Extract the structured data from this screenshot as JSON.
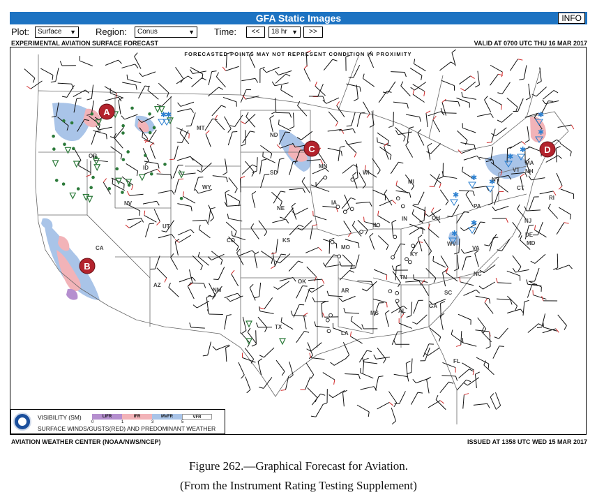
{
  "header": {
    "title": "GFA Static Images",
    "info_label": "INFO"
  },
  "controls": {
    "plot_label": "Plot:",
    "plot_value": "Surface",
    "region_label": "Region:",
    "region_value": "Conus",
    "time_label": "Time:",
    "prev_label": "<<",
    "time_value": "18 hr",
    "next_label": ">>"
  },
  "map": {
    "product": "EXPERIMENTAL AVIATION SURFACE FORECAST",
    "valid": "VALID AT 0700 UTC THU 16 MAR 2017",
    "note": "FORECASTED POINTS MAY NOT REPRESENT CONDITION IN PROXIMITY",
    "issued_by": "AVIATION WEATHER CENTER (NOAA/NWS/NCEP)",
    "issued": "ISSUED AT 1358 UTC WED 15 MAR 2017",
    "markers": [
      "A",
      "B",
      "C",
      "D"
    ],
    "state_labels": [
      "OR",
      "ID",
      "MT",
      "ND",
      "SD",
      "MN",
      "WI",
      "MI",
      "NY",
      "VT",
      "NH",
      "MA",
      "RI",
      "CT",
      "NJ",
      "PA",
      "OH",
      "IN",
      "IL",
      "IA",
      "NE",
      "WY",
      "UT",
      "NV",
      "CA",
      "AZ",
      "NM",
      "CO",
      "KS",
      "MO",
      "KY",
      "WV",
      "VA",
      "DE",
      "MD",
      "NC",
      "SC",
      "GA",
      "AL",
      "MS",
      "TN",
      "AR",
      "LA",
      "OK",
      "TX",
      "FL"
    ]
  },
  "legend": {
    "visibility_label": "VISIBILITY (SM)",
    "categories": [
      "LIFR",
      "IFR",
      "MVFR",
      "VFR"
    ],
    "ticks": [
      "0",
      "1",
      "3",
      "5"
    ],
    "winds_label": "SURFACE WINDS/GUSTS(RED) AND PREDOMINANT WEATHER",
    "colors": {
      "LIFR": "#b58fcf",
      "IFR": "#f2b3b8",
      "MVFR": "#a9c4e8",
      "VFR": "#ffffff",
      "marker": "#b3232d",
      "title_bar": "#1d73c2",
      "rain": "#2c7a3a",
      "snow": "#2a7fd0"
    }
  },
  "caption": {
    "line1": "Figure 262.—Graphical Forecast for Aviation.",
    "line2": "(From the Instrument Rating Testing Supplement)"
  }
}
